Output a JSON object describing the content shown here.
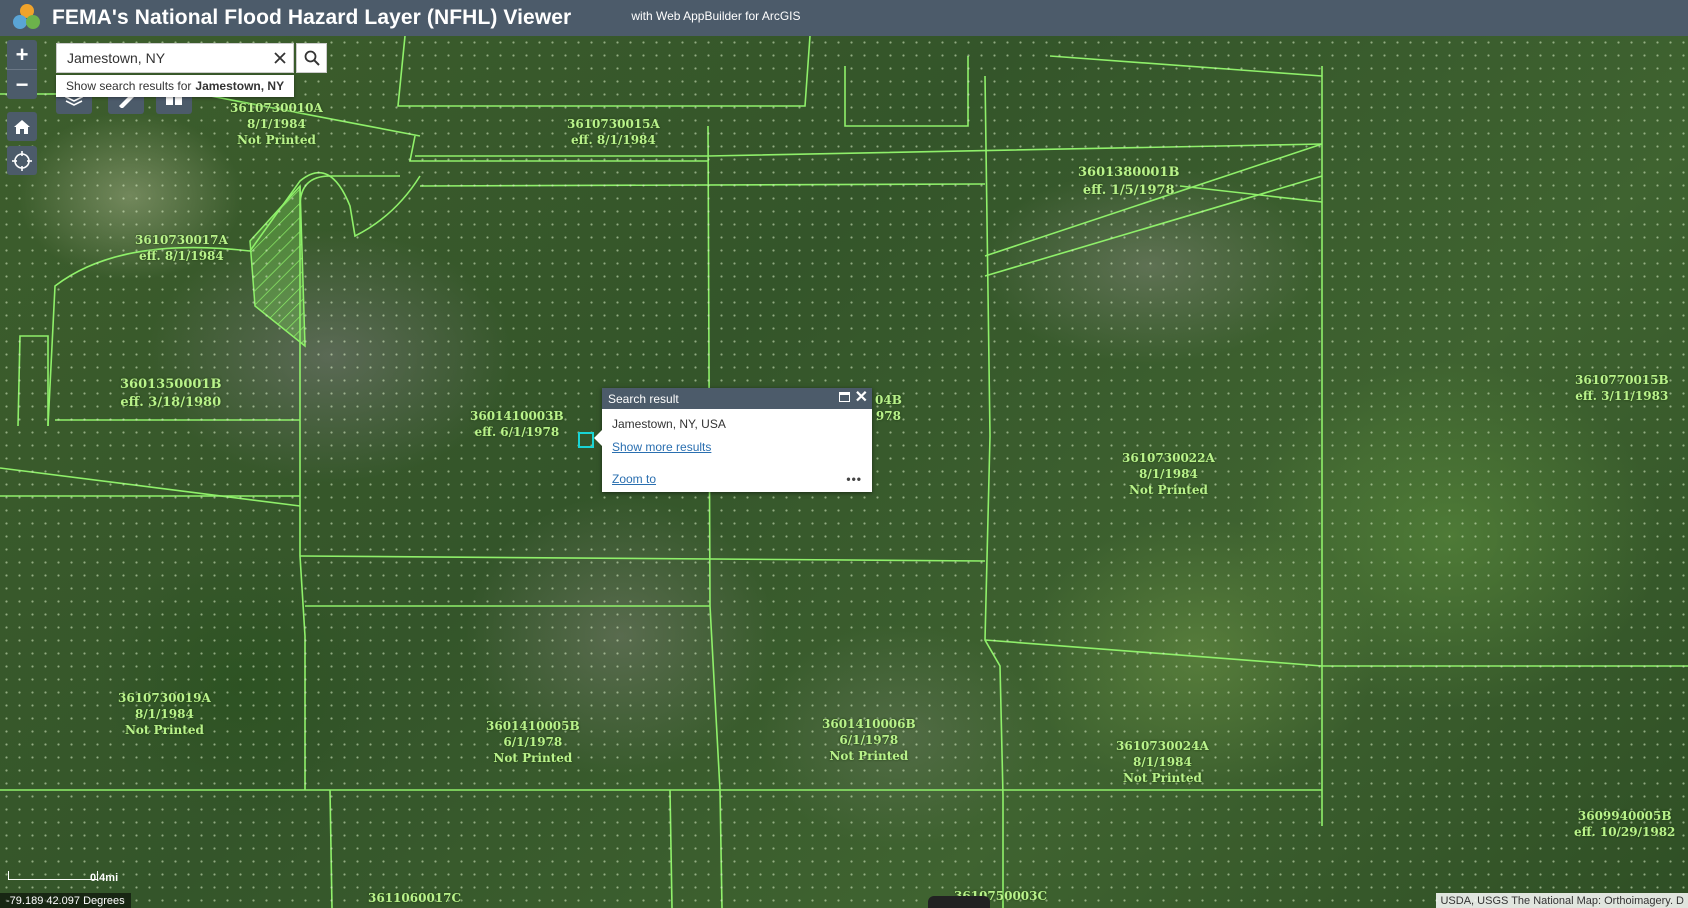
{
  "header": {
    "title": "FEMA's National Flood Hazard Layer (NFHL) Viewer",
    "subtitle": "with Web AppBuilder for ArcGIS"
  },
  "search": {
    "value": "Jamestown, NY",
    "suggestion_prefix": "Show search results for",
    "suggestion_term": "Jamestown, NY"
  },
  "controls": {
    "zoom_in": "+",
    "zoom_out": "−"
  },
  "popup": {
    "title": "Search result",
    "result": "Jamestown, NY, USA",
    "more_link": "Show more results",
    "zoom_link": "Zoom to",
    "more_actions": "•••"
  },
  "panels": [
    {
      "id": "3610730010A",
      "l2": "8/1/1984",
      "l3": "Not Printed"
    },
    {
      "id": "3610730015A",
      "l2": "eff. 8/1/1984"
    },
    {
      "id": "3601380001B",
      "l2": "eff. 1/5/1978"
    },
    {
      "id": "3610730017A",
      "l2": "eff. 8/1/1984"
    },
    {
      "id": "3601350001B",
      "l2": "eff. 3/18/1980"
    },
    {
      "id": "3601410003B",
      "l2": "eff. 6/1/1978"
    },
    {
      "id": "3610770015B",
      "l2": "eff. 3/11/1983"
    },
    {
      "id": "3610730022A",
      "l2": "8/1/1984",
      "l3": "Not Printed"
    },
    {
      "id": "3610730019A",
      "l2": "8/1/1984",
      "l3": "Not Printed"
    },
    {
      "id": "3601410005B",
      "l2": "6/1/1978",
      "l3": "Not Printed"
    },
    {
      "id": "3601410006B",
      "l2": "6/1/1978",
      "l3": "Not Printed"
    },
    {
      "id": "3610730024A",
      "l2": "8/1/1984",
      "l3": "Not Printed"
    },
    {
      "id": "3609940005B",
      "l2": "eff. 10/29/1982"
    },
    {
      "id": "3611060017C"
    },
    {
      "id": "3610750003C"
    }
  ],
  "partial_labels": [
    "04B",
    "978"
  ],
  "footer": {
    "scale": "0.4mi",
    "coordinates": "-79.189 42.097 Degrees",
    "attribution": "USDA, USGS The National Map: Orthoimagery. D"
  }
}
